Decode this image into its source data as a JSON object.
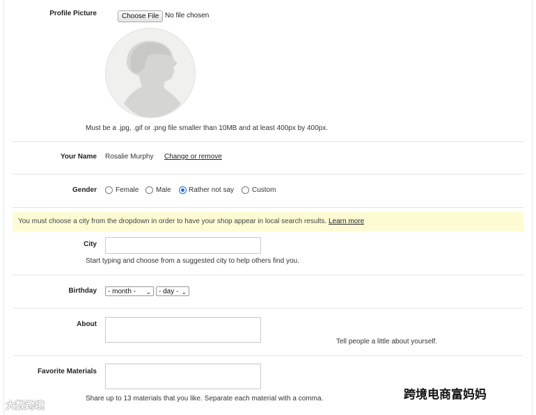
{
  "profile_picture": {
    "label": "Profile Picture",
    "choose_file_label": "Choose File",
    "no_file_text": "No file chosen",
    "hint": "Must be a .jpg, .gif or .png file smaller than 10MB and at least 400px by 400px."
  },
  "name": {
    "label": "Your Name",
    "value": "Rosalie Murphy",
    "change_link": "Change or remove"
  },
  "gender": {
    "label": "Gender",
    "options": [
      "Female",
      "Male",
      "Rather not say",
      "Custom"
    ],
    "selected": "Rather not say"
  },
  "notice": {
    "text": "You must choose a city from the dropdown in order to have your shop appear in local search results.",
    "link": "Learn more"
  },
  "city": {
    "label": "City",
    "value": "",
    "hint": "Start typing and choose from a suggested city to help others find you."
  },
  "birthday": {
    "label": "Birthday",
    "month_value": "- month -",
    "day_value": "- day -"
  },
  "about": {
    "label": "About",
    "value": "",
    "hint": "Tell people a little about yourself."
  },
  "favorite_materials": {
    "label": "Favorite Materials",
    "value": "",
    "hint": "Share up to 13 materials that you like. Separate each material with a comma."
  },
  "watermarks": {
    "left": "大数跨境",
    "right": "跨境电商富妈妈"
  },
  "colors": {
    "notice_bg": "#fdfbd4",
    "radio_accent": "#1a6fe0"
  }
}
